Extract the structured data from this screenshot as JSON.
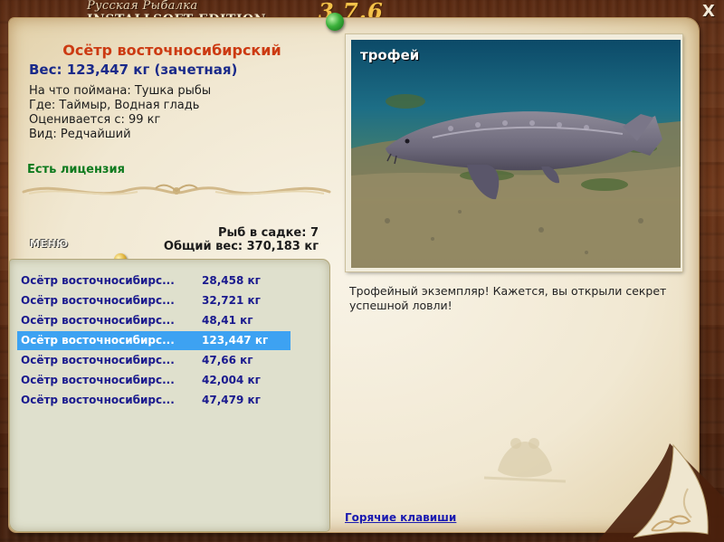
{
  "app": {
    "title_line1": "Русская Рыбалка",
    "title_line2": "INSTALLSOFT EDITION",
    "version": "3.7.6",
    "close_label": "X"
  },
  "fish": {
    "name": "Осётр восточносибирский",
    "weight": "Вес: 123,447 кг (зачетная)",
    "details": [
      "На что поймана: Тушка рыбы",
      "Где: Таймыр, Водная гладь",
      "Оценивается с: 99 кг",
      "Вид: Редчайший"
    ],
    "license": "Есть лицензия"
  },
  "keepnet": {
    "count_text": "Рыб в садке: 7",
    "total_text": "Общий вес: 370,183 кг"
  },
  "menu_label": "МЕНЮ",
  "catch_list": [
    {
      "name": "Осётр восточносибирс...",
      "weight": "28,458 кг",
      "selected": false
    },
    {
      "name": "Осётр восточносибирс...",
      "weight": "32,721 кг",
      "selected": false
    },
    {
      "name": "Осётр восточносибирс...",
      "weight": "48,41 кг",
      "selected": false
    },
    {
      "name": "Осётр восточносибирс...",
      "weight": "123,447 кг",
      "selected": true
    },
    {
      "name": "Осётр восточносибирс...",
      "weight": "47,66 кг",
      "selected": false
    },
    {
      "name": "Осётр восточносибирс...",
      "weight": "42,004 кг",
      "selected": false
    },
    {
      "name": "Осётр восточносибирс...",
      "weight": "47,479 кг",
      "selected": false
    }
  ],
  "photo": {
    "label": "трофей",
    "subject": "sturgeon-underwater"
  },
  "trophy_message": "Трофейный экземпляр! Кажется, вы открыли секрет успешной ловли!",
  "hotkeys_label": "Горячие клавиши",
  "colors": {
    "fish_name": "#cc3a12",
    "weight": "#1a2a8a",
    "license": "#0e7a1e",
    "list_text": "#1a1a8e",
    "list_selected_bg": "#3da2f2",
    "version": "#f4c24a"
  }
}
